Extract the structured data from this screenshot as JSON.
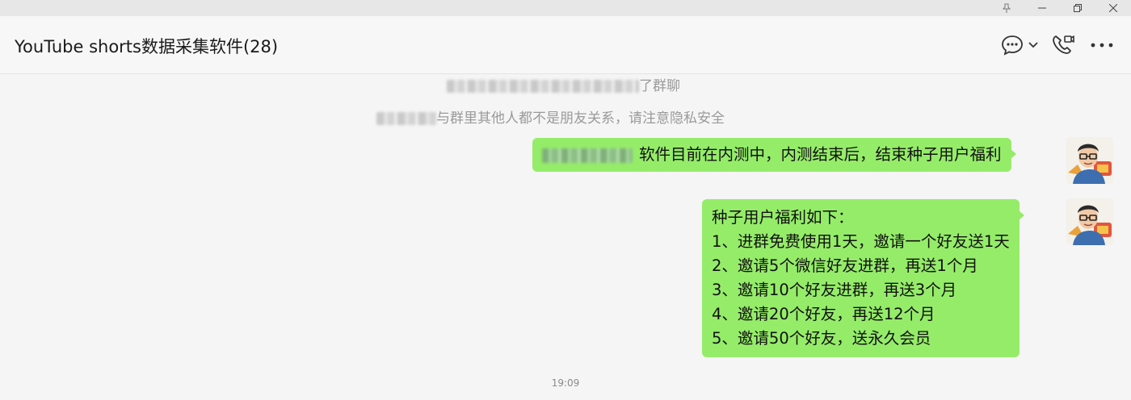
{
  "window": {
    "controls": [
      "pin-icon",
      "minimize-icon",
      "restore-icon",
      "close-icon"
    ]
  },
  "header": {
    "title": "YouTube shorts数据采集软件(28)",
    "icons": [
      "chat-bubble-icon",
      "chevron-down-icon",
      "video-call-icon",
      "more-icon"
    ]
  },
  "system_messages": {
    "joined_suffix": "了群聊",
    "privacy_suffix": "与群里其他人都不是朋友关系，请注意隐私安全"
  },
  "messages": [
    {
      "text": "软件目前在内测中，内测结束后，结束种子用户福利"
    },
    {
      "lines": [
        "种子用户福利如下：",
        "1、进群免费使用1天，邀请一个好友送1天",
        "2、邀请5个微信好友进群，再送1个月",
        "3、邀请10个好友进群，再送3个月",
        "4、邀请20个好友，再送12个月",
        "5、邀请50个好友，送永久会员"
      ]
    }
  ],
  "timestamp": "19:09",
  "colors": {
    "bubble": "#95ec69",
    "background": "#f5f5f5",
    "system_text": "#9a9a9a"
  }
}
